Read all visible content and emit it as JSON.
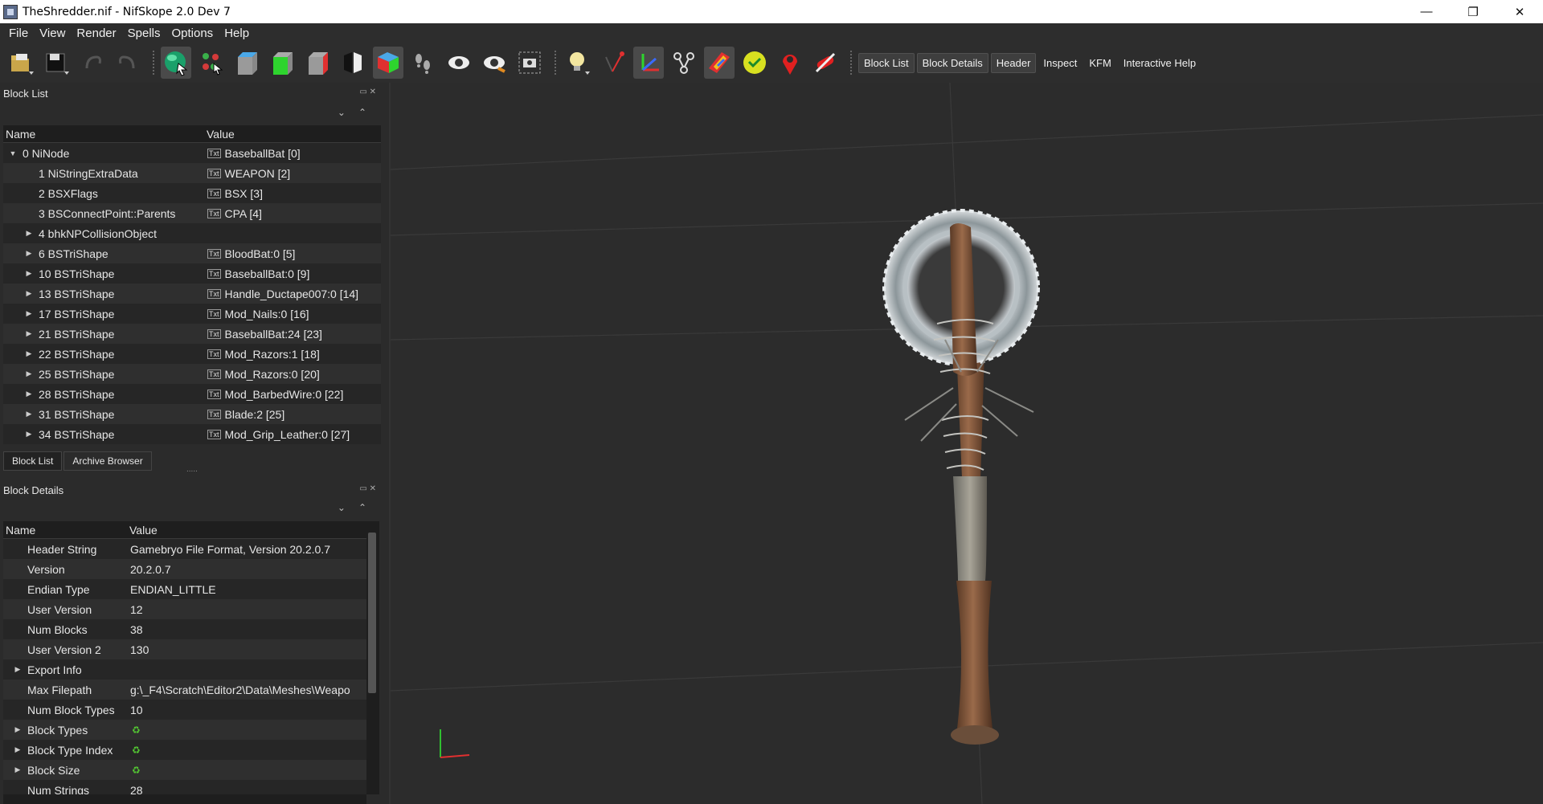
{
  "window": {
    "title": "TheShredder.nif - NifSkope 2.0 Dev 7",
    "minimize_glyph": "—",
    "restore_glyph": "❐",
    "close_glyph": "✕"
  },
  "menu": [
    "File",
    "View",
    "Render",
    "Spells",
    "Options",
    "Help"
  ],
  "toolbar": {
    "icons": [
      "load-icon",
      "save-icon",
      "undo-icon",
      "redo-icon",
      "select-icon",
      "select-vertex-icon",
      "view-top-icon",
      "view-front-icon",
      "view-side-icon",
      "view-user-icon",
      "view-flip-icon",
      "walk-mode-icon",
      "show-icon",
      "hide-icon",
      "screenshot-icon",
      "lighting-icon",
      "textures-icon",
      "axes-icon",
      "nodes-icon",
      "vertex-colors-icon",
      "specular-icon",
      "markers-icon",
      "collision-icon"
    ],
    "text_buttons": [
      "Block List",
      "Block Details",
      "Header",
      "Inspect",
      "KFM",
      "Interactive Help"
    ]
  },
  "block_list": {
    "title": "Block List",
    "columns": [
      "Name",
      "Value"
    ],
    "rows": [
      {
        "name": "0 NiNode",
        "value": "BaseballBat [0]",
        "expander": "open",
        "level": 0
      },
      {
        "name": "1 NiStringExtraData",
        "value": "WEAPON [2]",
        "expander": "none",
        "level": 1
      },
      {
        "name": "2 BSXFlags",
        "value": "BSX [3]",
        "expander": "none",
        "level": 1
      },
      {
        "name": "3 BSConnectPoint::Parents",
        "value": "CPA [4]",
        "expander": "none",
        "level": 1
      },
      {
        "name": "4 bhkNPCollisionObject",
        "value": "",
        "expander": "closed",
        "level": 1
      },
      {
        "name": "6 BSTriShape",
        "value": "BloodBat:0 [5]",
        "expander": "closed",
        "level": 1
      },
      {
        "name": "10 BSTriShape",
        "value": "BaseballBat:0 [9]",
        "expander": "closed",
        "level": 1
      },
      {
        "name": "13 BSTriShape",
        "value": "Handle_Ductape007:0 [14]",
        "expander": "closed",
        "level": 1
      },
      {
        "name": "17 BSTriShape",
        "value": "Mod_Nails:0 [16]",
        "expander": "closed",
        "level": 1
      },
      {
        "name": "21 BSTriShape",
        "value": "BaseballBat:24 [23]",
        "expander": "closed",
        "level": 1
      },
      {
        "name": "22 BSTriShape",
        "value": "Mod_Razors:1 [18]",
        "expander": "closed",
        "level": 1
      },
      {
        "name": "25 BSTriShape",
        "value": "Mod_Razors:0 [20]",
        "expander": "closed",
        "level": 1
      },
      {
        "name": "28 BSTriShape",
        "value": "Mod_BarbedWire:0 [22]",
        "expander": "closed",
        "level": 1
      },
      {
        "name": "31 BSTriShape",
        "value": "Blade:2 [25]",
        "expander": "closed",
        "level": 1
      },
      {
        "name": "34 BSTriShape",
        "value": "Mod_Grip_Leather:0 [27]",
        "expander": "closed",
        "level": 1
      }
    ],
    "tabs": [
      "Block List",
      "Archive Browser"
    ],
    "handle": "....."
  },
  "block_details": {
    "title": "Block Details",
    "columns": [
      "Name",
      "Value"
    ],
    "rows": [
      {
        "name": "Header String",
        "value": "Gamebryo File Format, Version 20.2.0.7",
        "expander": "none",
        "icon": ""
      },
      {
        "name": "Version",
        "value": "20.2.0.7",
        "expander": "none",
        "icon": ""
      },
      {
        "name": "Endian Type",
        "value": "ENDIAN_LITTLE",
        "expander": "none",
        "icon": ""
      },
      {
        "name": "User Version",
        "value": "12",
        "expander": "none",
        "icon": ""
      },
      {
        "name": "Num Blocks",
        "value": "38",
        "expander": "none",
        "icon": ""
      },
      {
        "name": "User Version 2",
        "value": "130",
        "expander": "none",
        "icon": ""
      },
      {
        "name": "Export Info",
        "value": "",
        "expander": "closed",
        "icon": ""
      },
      {
        "name": "Max Filepath",
        "value": "g:\\_F4\\Scratch\\Editor2\\Data\\Meshes\\Weapo",
        "expander": "none",
        "icon": ""
      },
      {
        "name": "Num Block Types",
        "value": "10",
        "expander": "none",
        "icon": ""
      },
      {
        "name": "Block Types",
        "value": "",
        "expander": "closed",
        "icon": "refresh-icon"
      },
      {
        "name": "Block Type Index",
        "value": "",
        "expander": "closed",
        "icon": "refresh-icon"
      },
      {
        "name": "Block Size",
        "value": "",
        "expander": "closed",
        "icon": "refresh-icon"
      },
      {
        "name": "Num Strings",
        "value": "28",
        "expander": "none",
        "icon": ""
      }
    ]
  },
  "colors": {
    "bg": "#2b2b2b",
    "viewport": "#2c2c2c",
    "axis_x": "#e03030",
    "axis_y": "#30c030",
    "wood": "#8a5a3c"
  }
}
